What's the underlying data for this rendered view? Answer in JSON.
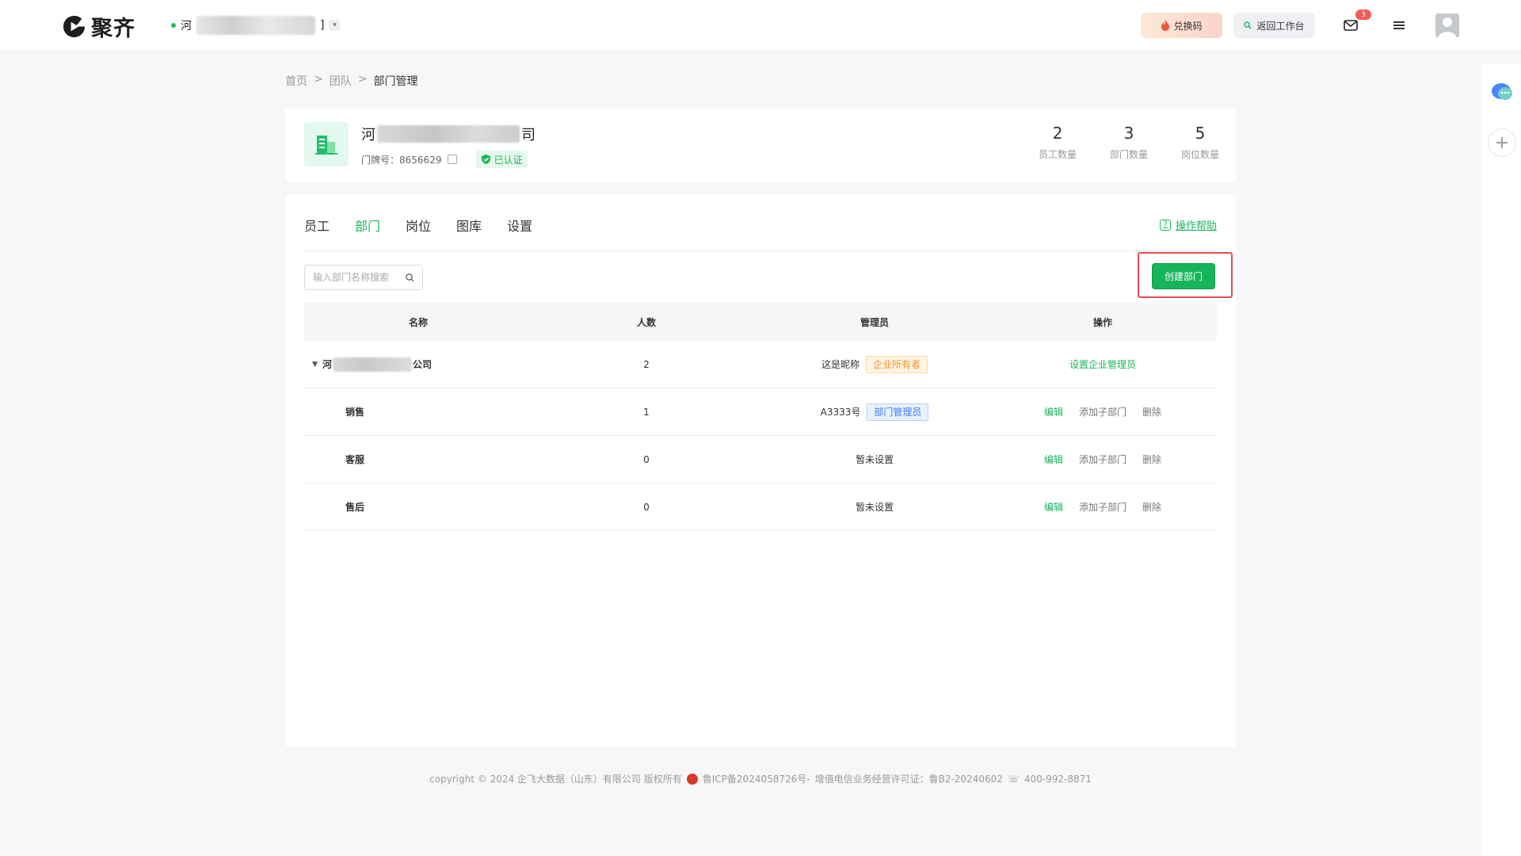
{
  "header": {
    "logo_text": "聚齐",
    "org_prefix": "河",
    "org_suffix": "]",
    "redeem_label": "兑换码",
    "back_label": "返回工作台",
    "mail_badge": "3"
  },
  "breadcrumb": {
    "home": "首页",
    "team": "团队",
    "current": "部门管理",
    "separator": ">"
  },
  "company": {
    "name_prefix": "河",
    "name_suffix": "司",
    "house_label": "门牌号：",
    "house_number": "8656629",
    "verified_label": "已认证",
    "stats": [
      {
        "value": "2",
        "label": "员工数量"
      },
      {
        "value": "3",
        "label": "部门数量"
      },
      {
        "value": "5",
        "label": "岗位数量"
      }
    ]
  },
  "tabs": [
    "员工",
    "部门",
    "岗位",
    "图库",
    "设置"
  ],
  "active_tab": "部门",
  "help_label": "操作帮助",
  "search": {
    "placeholder": "输入部门名称搜索"
  },
  "create_label": "创建部门",
  "table": {
    "headers": [
      "名称",
      "人数",
      "管理员",
      "操作"
    ],
    "root": {
      "name_prefix": "河",
      "name_suffix": "公司",
      "count": "2",
      "admin": "这是昵称",
      "admin_tag": "企业所有者",
      "action": "设置企业管理员"
    },
    "rows": [
      {
        "name": "销售",
        "count": "1",
        "admin": "A3333号",
        "admin_tag": "部门管理员",
        "edit": "编辑",
        "add_child": "添加子部门",
        "delete": "删除"
      },
      {
        "name": "客服",
        "count": "0",
        "admin": "暂未设置",
        "admin_tag": "",
        "edit": "编辑",
        "add_child": "添加子部门",
        "delete": "删除"
      },
      {
        "name": "售后",
        "count": "0",
        "admin": "暂未设置",
        "admin_tag": "",
        "edit": "编辑",
        "add_child": "添加子部门",
        "delete": "删除"
      }
    ]
  },
  "footer": {
    "copyright": "copyright © 2024 企飞大数据（山东）有限公司 版权所有",
    "icp": "鲁ICP备2024058726号-",
    "license": "增值电信业务经营许可证：鲁B2-20240602",
    "phone": "400-992-8871"
  },
  "colors": {
    "accent": "#19b55a",
    "highlight_border": "#e84a58",
    "badge": "#f25b5b"
  }
}
